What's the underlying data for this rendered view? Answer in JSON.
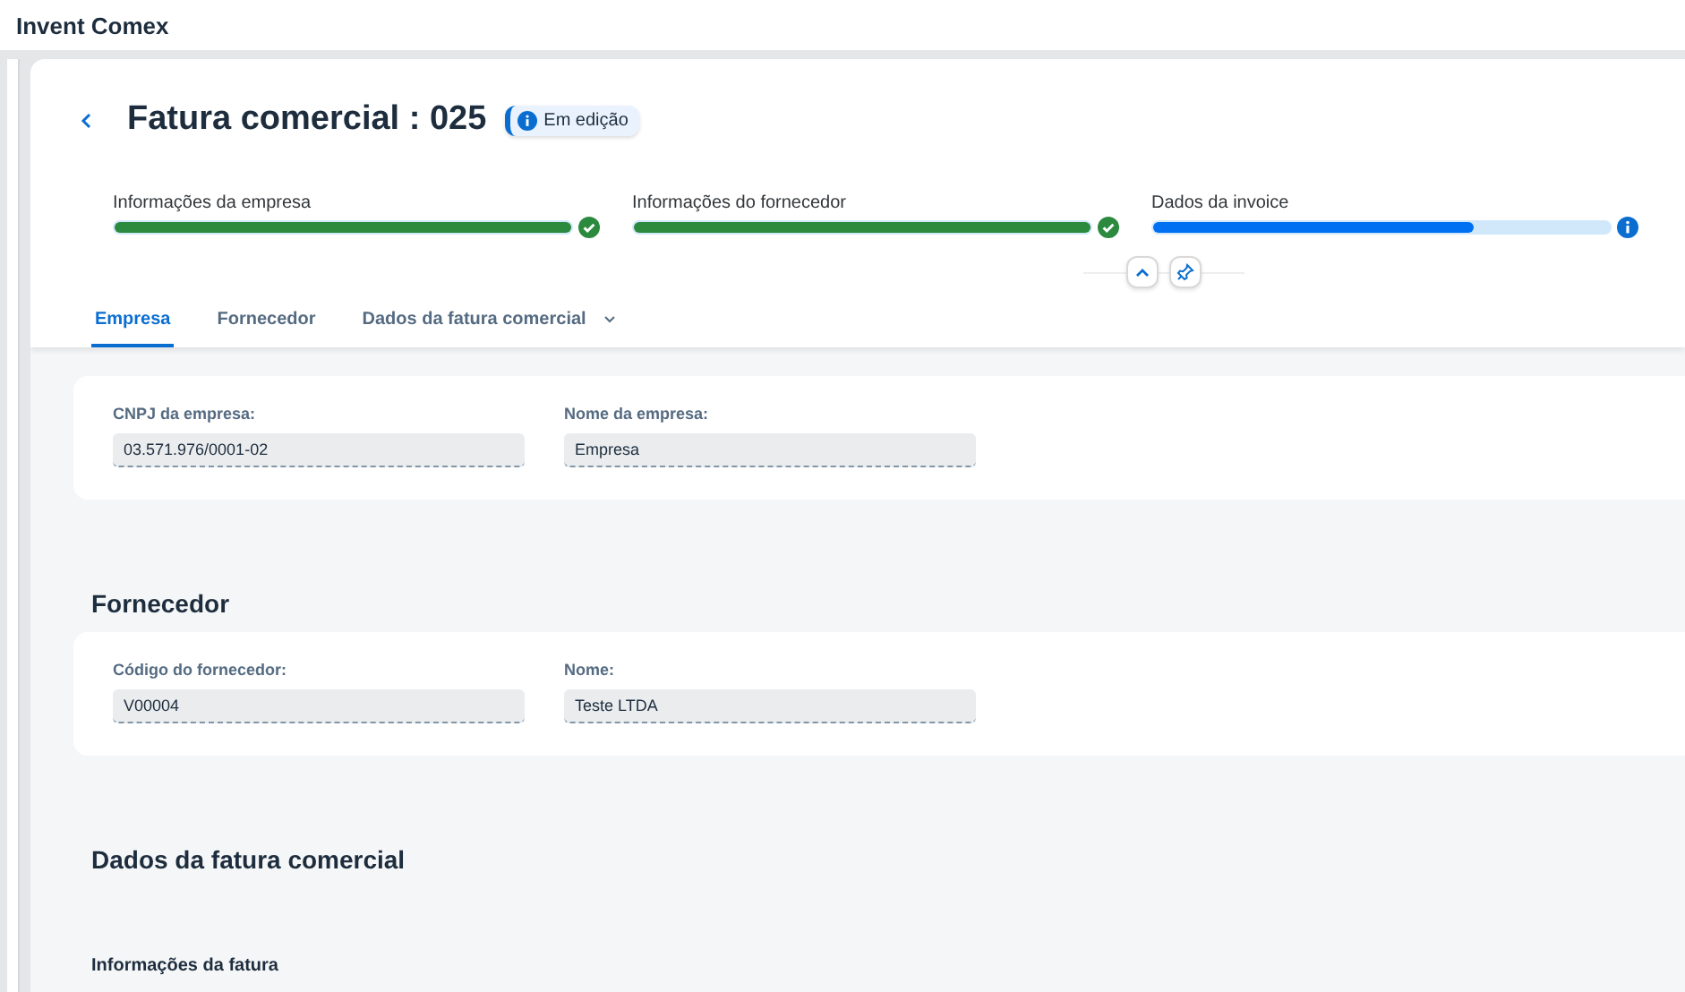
{
  "app": {
    "title": "Invent Comex"
  },
  "header": {
    "title": "Fatura comercial : 025",
    "badge": "Em edição"
  },
  "steps": [
    {
      "label": "Informações da empresa",
      "level": 1,
      "kind": "done"
    },
    {
      "label": "Informações do fornecedor",
      "level": 1,
      "kind": "done"
    },
    {
      "label": "Dados da invoice",
      "level": 0.7,
      "kind": "current"
    }
  ],
  "tabs": [
    {
      "label": "Empresa",
      "selected": true,
      "dropdown": false
    },
    {
      "label": "Fornecedor",
      "selected": false,
      "dropdown": false
    },
    {
      "label": "Dados da fatura comercial",
      "selected": false,
      "dropdown": true
    }
  ],
  "sections": [
    {
      "fields": [
        {
          "label": "CNPJ da empresa:",
          "value": "03.571.976/0001-02"
        },
        {
          "label": "Nome da empresa:",
          "value": "Empresa"
        }
      ]
    },
    {
      "title": "Fornecedor",
      "fields": [
        {
          "label": "Código do fornecedor:",
          "value": "V00004"
        },
        {
          "label": "Nome:",
          "value": "Teste LTDA"
        }
      ]
    }
  ],
  "invoice": {
    "title": "Dados da fatura comercial",
    "subtitle": "Informações da fatura"
  }
}
